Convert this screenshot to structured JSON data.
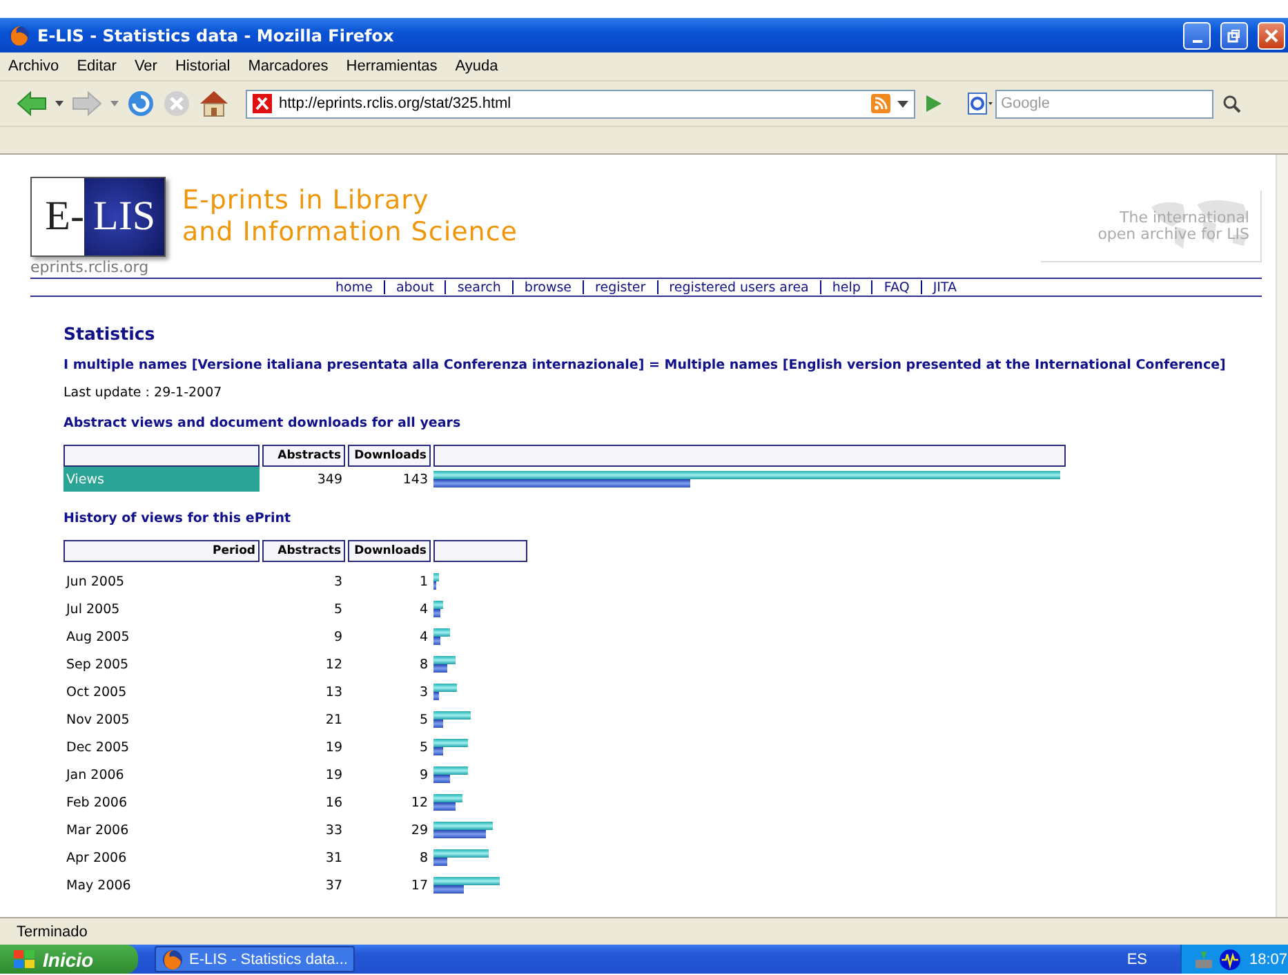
{
  "window": {
    "title": "E-LIS - Statistics data - Mozilla Firefox"
  },
  "menu": [
    "Archivo",
    "Editar",
    "Ver",
    "Historial",
    "Marcadores",
    "Herramientas",
    "Ayuda"
  ],
  "toolbar": {
    "url": "http://eprints.rclis.org/stat/325.html",
    "search_placeholder": "Google"
  },
  "site": {
    "logo_left": "E-",
    "logo_right": "LIS",
    "domain": "eprints.rclis.org",
    "title_lines": [
      "E-prints in Library",
      "and Information Science"
    ],
    "tagline_lines": [
      "The international",
      "open archive for LIS"
    ]
  },
  "nav": [
    "home",
    "about",
    "search",
    "browse",
    "register",
    "registered users area",
    "help",
    "FAQ",
    "JITA"
  ],
  "heading": "Statistics",
  "document_title": "I multiple names [Versione italiana presentata alla Conferenza internazionale] = Multiple names [English version presented at the International Conference]",
  "last_update": "Last update : 29-1-2007",
  "summary": {
    "title": "Abstract views and document downloads for all years",
    "columns": [
      "Abstracts",
      "Downloads"
    ],
    "rows": [
      {
        "label": "Views",
        "abstracts": "349",
        "downloads": "143"
      }
    ]
  },
  "history": {
    "title": "History of views for this ePrint",
    "columns": [
      "Period",
      "Abstracts",
      "Downloads"
    ],
    "rows": [
      {
        "period": "Jun 2005",
        "abstracts": "3",
        "downloads": "1"
      },
      {
        "period": "Jul 2005",
        "abstracts": "5",
        "downloads": "4"
      },
      {
        "period": "Aug 2005",
        "abstracts": "9",
        "downloads": "4"
      },
      {
        "period": "Sep 2005",
        "abstracts": "12",
        "downloads": "8"
      },
      {
        "period": "Oct 2005",
        "abstracts": "13",
        "downloads": "3"
      },
      {
        "period": "Nov 2005",
        "abstracts": "21",
        "downloads": "5"
      },
      {
        "period": "Dec 2005",
        "abstracts": "19",
        "downloads": "5"
      },
      {
        "period": "Jan 2006",
        "abstracts": "19",
        "downloads": "9"
      },
      {
        "period": "Feb 2006",
        "abstracts": "16",
        "downloads": "12"
      },
      {
        "period": "Mar 2006",
        "abstracts": "33",
        "downloads": "29"
      },
      {
        "period": "Apr 2006",
        "abstracts": "31",
        "downloads": "8"
      },
      {
        "period": "May 2006",
        "abstracts": "37",
        "downloads": "17"
      }
    ]
  },
  "status_bar": "Terminado",
  "taskbar": {
    "start": "Inicio",
    "task": "E-LIS - Statistics data...",
    "language": "ES",
    "clock": "18:07"
  }
}
